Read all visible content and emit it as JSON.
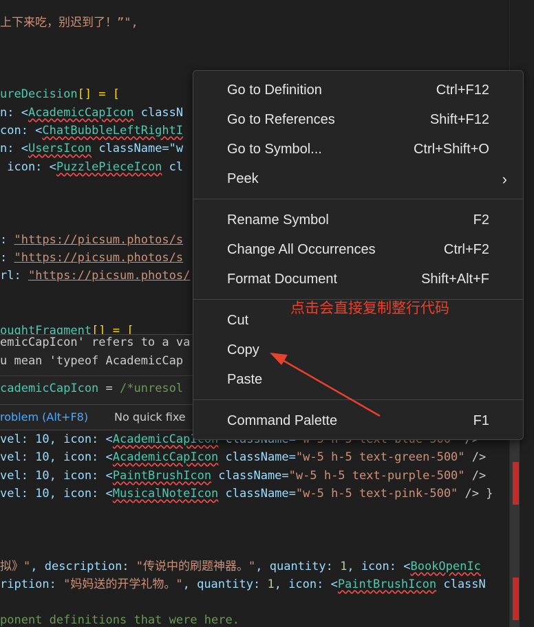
{
  "editor": {
    "l1": [
      "",
      "上下来吃，别迟到了！”\","
    ],
    "l2": [
      "ureDecision",
      "[] = ["
    ],
    "l3": [
      "n: <",
      "AcademicCapIcon",
      " classN"
    ],
    "l4": [
      "con: <",
      "ChatBubbleLeftRightI"
    ],
    "l5": [
      "n: <",
      "UsersIcon",
      " className=\"w"
    ],
    "l6": [
      " icon: <",
      "PuzzlePieceIcon",
      " cl"
    ],
    "l7": [
      ": ",
      "\"https://picsum.photos/s"
    ],
    "l8": [
      ": ",
      "\"https://picsum.photos/s"
    ],
    "l9": [
      "rl: ",
      "\"https://picsum.photos/"
    ],
    "l10": [
      "oughtFragment",
      "[] = ["
    ],
    "l11": [
      "vel: 10, icon: <",
      "AcademicCapIcon",
      " className=",
      "\"w-5 h-5 text-blue-500\"",
      " />"
    ],
    "l12": [
      "vel: 10, icon: <",
      "AcademicCapIcon",
      " className=",
      "\"w-5 h-5 text-green-500\"",
      " />"
    ],
    "l13": [
      "vel: 10, icon: <",
      "PaintBrushIcon",
      " className=",
      "\"w-5 h-5 text-purple-500\"",
      " />"
    ],
    "l14": [
      "vel: 10, icon: <",
      "MusicalNoteIcon",
      " className=",
      "\"w-5 h-5 text-pink-500\"",
      " /> }"
    ],
    "l15": [
      "拟》\"",
      ", description: ",
      "\"传说中的刷题神器。\"",
      ", quantity: ",
      "1",
      ", icon: <",
      "BookOpenIc"
    ],
    "l16": [
      "ription: ",
      "\"妈妈送的开学礼物。\"",
      ", quantity: ",
      "1",
      ", icon: <",
      "PaintBrushIcon",
      " classN"
    ],
    "l17": [
      "ponent definitions that were here."
    ]
  },
  "hover": {
    "msg1": "emicCapIcon' refers to a va",
    "msg2": "u mean 'typeof AcademicCap",
    "code": [
      "cademicCapIcon",
      " = ",
      "/*unresol"
    ],
    "fix_label": "roblem (Alt+F8)",
    "no_fix_label": "No quick fixe"
  },
  "context_menu": {
    "groups": [
      [
        {
          "label": "Go to Definition",
          "shortcut": "Ctrl+F12"
        },
        {
          "label": "Go to References",
          "shortcut": "Shift+F12"
        },
        {
          "label": "Go to Symbol...",
          "shortcut": "Ctrl+Shift+O"
        },
        {
          "label": "Peek",
          "shortcut": "",
          "submenu": "›"
        }
      ],
      [
        {
          "label": "Rename Symbol",
          "shortcut": "F2"
        },
        {
          "label": "Change All Occurrences",
          "shortcut": "Ctrl+F2"
        },
        {
          "label": "Format Document",
          "shortcut": "Shift+Alt+F"
        }
      ],
      [
        {
          "label": "Cut",
          "shortcut": ""
        },
        {
          "label": "Copy",
          "shortcut": ""
        },
        {
          "label": "Paste",
          "shortcut": ""
        }
      ],
      [
        {
          "label": "Command Palette",
          "shortcut": "F1"
        }
      ]
    ]
  },
  "annotation": {
    "text": "点击会直接复制整行代码",
    "color": "#e8412c"
  }
}
